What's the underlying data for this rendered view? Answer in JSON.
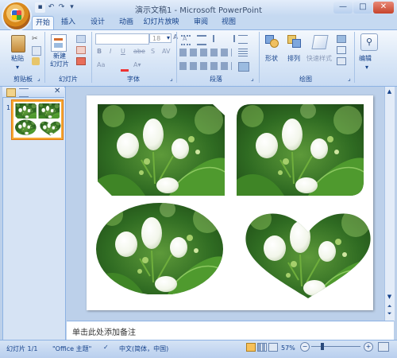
{
  "window": {
    "title": "演示文稿1 - Microsoft PowerPoint"
  },
  "tabs": [
    "开始",
    "插入",
    "设计",
    "动画",
    "幻灯片放映",
    "审阅",
    "视图"
  ],
  "active_tab": "开始",
  "ribbon": {
    "clipboard": {
      "paste_label": "粘贴",
      "group_label": "剪贴板"
    },
    "slides": {
      "new_slide_label": "新建\n幻灯片",
      "group_label": "幻灯片"
    },
    "font": {
      "size_value": "18",
      "group_label": "字体"
    },
    "paragraph": {
      "group_label": "段落"
    },
    "drawing": {
      "shape_label": "形状",
      "arrange_label": "排列",
      "quick_style_label": "快速样式",
      "group_label": "绘图"
    },
    "editing": {
      "edit_label": "编辑"
    }
  },
  "side_panel": {
    "slide_number": "1"
  },
  "notes": {
    "placeholder": "单击此处添加备注"
  },
  "status_bar": {
    "slide_info": "幻灯片 1/1",
    "theme": "\"Office 主题\"",
    "language": "中文(简体，中国)",
    "zoom": "57%"
  },
  "colors": {
    "accent": "#15428b",
    "ribbon_bg": "#d7e5f6",
    "window_bg": "#bcd0ea"
  }
}
